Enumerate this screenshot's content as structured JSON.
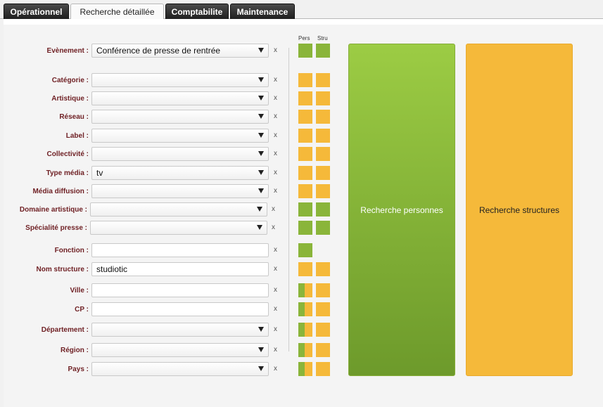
{
  "tabs": [
    {
      "label": "Opérationnel",
      "active": false
    },
    {
      "label": "Recherche détaillée",
      "active": true
    },
    {
      "label": "Comptabilite",
      "active": false
    },
    {
      "label": "Maintenance",
      "active": false
    }
  ],
  "columns": {
    "pers": "Pers",
    "stru": "Stru"
  },
  "clear_label": "x",
  "fields": [
    {
      "label": "Evènement :",
      "type": "select",
      "value": "Conférence de presse de rentrée",
      "pers": "green",
      "stru": "green"
    },
    {
      "label": "Catégorie :",
      "type": "select",
      "value": "",
      "pers": "orange",
      "stru": "orange"
    },
    {
      "label": "Artistique :",
      "type": "select",
      "value": "",
      "pers": "orange",
      "stru": "orange"
    },
    {
      "label": "Réseau :",
      "type": "select",
      "value": "",
      "pers": "orange",
      "stru": "orange"
    },
    {
      "label": "Label :",
      "type": "select",
      "value": "",
      "pers": "orange",
      "stru": "orange"
    },
    {
      "label": "Collectivité :",
      "type": "select",
      "value": "",
      "pers": "orange",
      "stru": "orange"
    },
    {
      "label": "Type média :",
      "type": "select",
      "value": "tv",
      "pers": "orange",
      "stru": "orange"
    },
    {
      "label": "Média diffusion :",
      "type": "select",
      "value": "",
      "pers": "orange",
      "stru": "orange"
    },
    {
      "label": "Domaine artistique :",
      "type": "select",
      "value": "",
      "pers": "green",
      "stru": "green"
    },
    {
      "label": "Spécialité presse :",
      "type": "select",
      "value": "",
      "pers": "green",
      "stru": "green"
    },
    {
      "label": "Fonction :",
      "type": "text",
      "value": "",
      "pers": "green",
      "stru": "none"
    },
    {
      "label": "Nom structure :",
      "type": "text",
      "value": "studiotic",
      "pers": "orange",
      "stru": "orange"
    },
    {
      "label": "Ville :",
      "type": "text",
      "value": "",
      "pers": "split",
      "stru": "orange"
    },
    {
      "label": "CP :",
      "type": "text",
      "value": "",
      "pers": "split",
      "stru": "orange"
    },
    {
      "label": "Département :",
      "type": "select",
      "value": "",
      "pers": "split",
      "stru": "orange"
    },
    {
      "label": "Région :",
      "type": "select",
      "value": "",
      "pers": "split",
      "stru": "orange"
    },
    {
      "label": "Pays :",
      "type": "select",
      "value": "",
      "pers": "split",
      "stru": "orange"
    }
  ],
  "actions": {
    "search_persons": "Recherche personnes",
    "search_structures": "Recherche structures"
  },
  "colors": {
    "green": "#8ab53a",
    "orange": "#f5b93a",
    "label": "#6e1f23"
  }
}
